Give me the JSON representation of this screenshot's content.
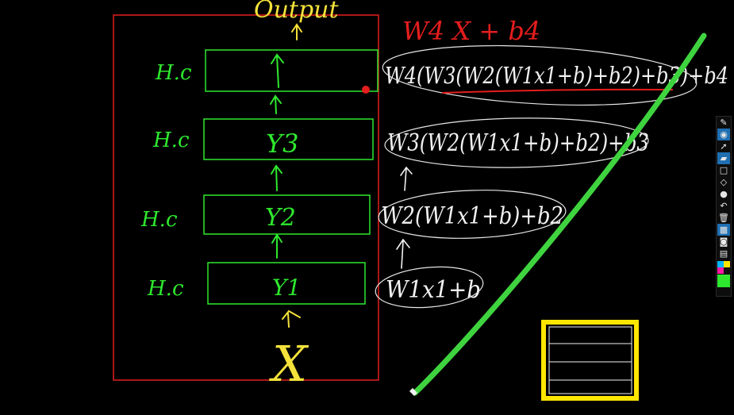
{
  "canvas": {
    "background": "#000000",
    "pen_colors": {
      "red": "#e51d1d",
      "green": "#2ee82e",
      "white": "#f2f2f2",
      "yellow": "#f5e23a"
    }
  },
  "diagram": {
    "output_label": "Output",
    "input_label": "X",
    "layers": [
      {
        "side_label": "H.c",
        "box_label": ""
      },
      {
        "side_label": "H.c",
        "box_label": "Y3"
      },
      {
        "side_label": "H.c",
        "box_label": "Y2"
      },
      {
        "side_label": "H.c",
        "box_label": "Y1"
      }
    ]
  },
  "equations": {
    "header": "W4 X + b4",
    "eq4": "W4(W3(W2(W1x1+b)+b2)+b3)+b4",
    "eq3": "W3(W2(W1x1+b)+b2)+b3",
    "eq2": "W2(W1x1+b)+b2",
    "eq1": "W1x1+b"
  },
  "toolbar": {
    "tools": [
      {
        "icon": "pen-icon",
        "glyph": "✎"
      },
      {
        "icon": "eye-icon",
        "glyph": "◉"
      },
      {
        "icon": "cursor-icon",
        "glyph": "➚"
      },
      {
        "icon": "highlighter-icon",
        "glyph": "▰"
      },
      {
        "icon": "rectangle-icon",
        "glyph": "□"
      },
      {
        "icon": "eraser-icon",
        "glyph": "◇"
      },
      {
        "icon": "dot-icon",
        "glyph": "●"
      },
      {
        "icon": "undo-icon",
        "glyph": "↶"
      },
      {
        "icon": "trash-icon",
        "glyph": "🗑"
      },
      {
        "icon": "clear-icon",
        "glyph": "▩"
      },
      {
        "icon": "camera-icon",
        "glyph": "◙"
      },
      {
        "icon": "clipboard-icon",
        "glyph": "▤"
      }
    ],
    "swatch_colors": [
      "#00b7ff",
      "#ffe600",
      "#ff1aa3",
      "#111111"
    ],
    "current_color": "#2ee82e"
  }
}
